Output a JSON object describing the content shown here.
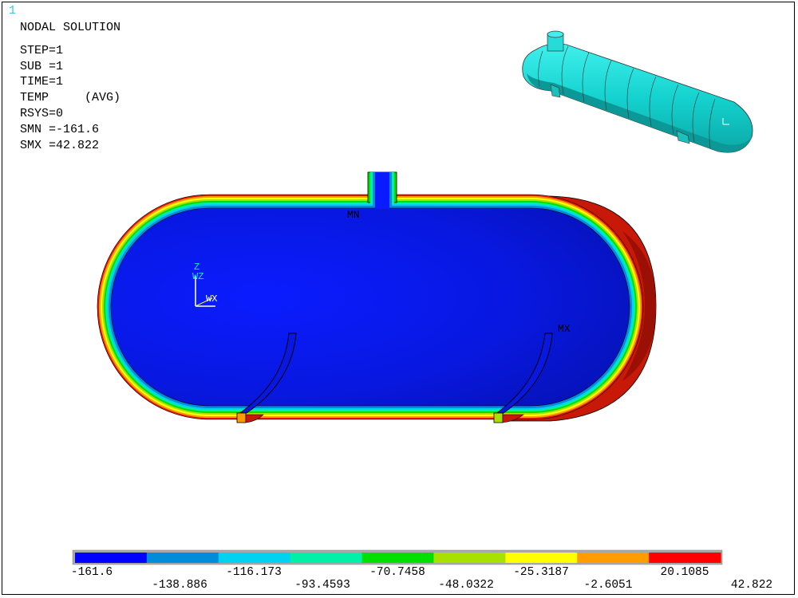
{
  "window_number": "1",
  "title": "NODAL SOLUTION",
  "info_lines": [
    "STEP=1",
    "SUB =1",
    "TIME=1",
    "TEMP     (AVG)",
    "RSYS=0",
    "SMN =-161.6",
    "SMX =42.822"
  ],
  "model_labels": {
    "min_marker": "MN",
    "max_marker": "MX"
  },
  "triad": {
    "z_label": "Z",
    "wz_label": "WZ",
    "x_label": "WX"
  },
  "legend": {
    "colors": [
      "#0000ff",
      "#008cd9",
      "#00d2f0",
      "#00f0a8",
      "#00e000",
      "#a8e000",
      "#ffff00",
      "#ff9c00",
      "#ff0000"
    ],
    "top_labels": [
      "-161.6",
      "-116.173",
      "-70.7458",
      "-25.3187",
      "20.1085"
    ],
    "bottom_labels": [
      "-138.886",
      "-93.4593",
      "-48.0322",
      "-2.6051",
      "42.822"
    ]
  }
}
